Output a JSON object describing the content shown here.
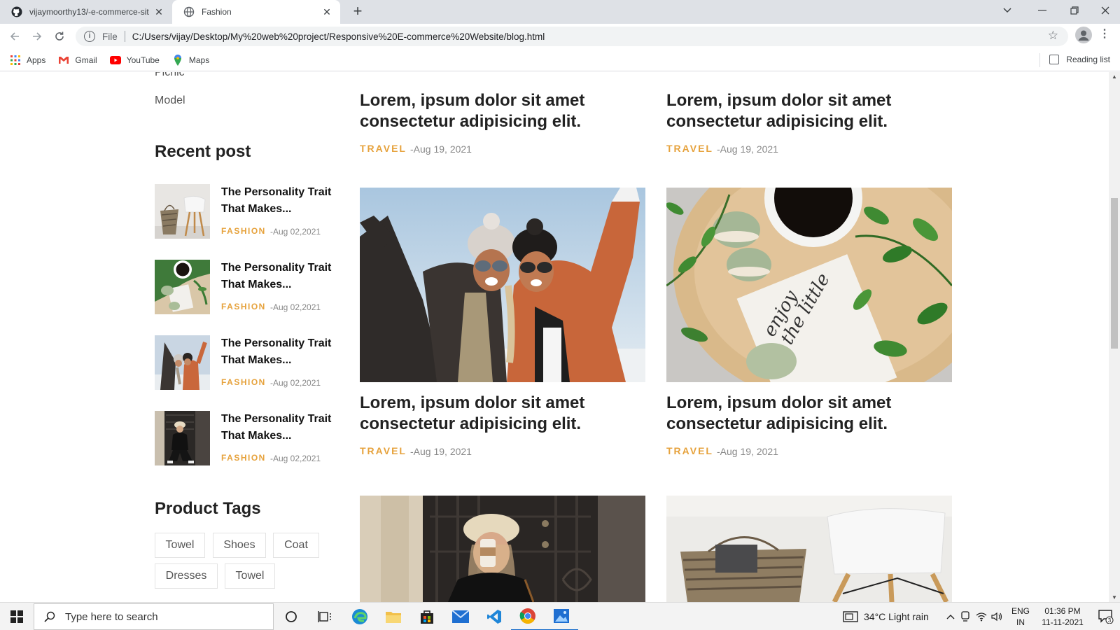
{
  "browser": {
    "tabs": [
      {
        "title": "vijaymoorthy13/-e-commerce-sit",
        "active": false
      },
      {
        "title": "Fashion",
        "active": true
      }
    ],
    "address": {
      "scheme_label": "File",
      "url": "C:/Users/vijay/Desktop/My%20web%20project/Responsive%20E-commerce%20Website/blog.html"
    },
    "bookmarks": [
      {
        "label": "Apps",
        "icon": "apps-grid-icon"
      },
      {
        "label": "Gmail",
        "icon": "gmail-icon"
      },
      {
        "label": "YouTube",
        "icon": "youtube-icon"
      },
      {
        "label": "Maps",
        "icon": "maps-icon"
      }
    ],
    "reading_list": "Reading list",
    "colors": {
      "tabstrip": "#dee1e6",
      "omnibox": "#f1f3f4"
    }
  },
  "sidebar": {
    "categories": [
      "Picnic",
      "Model"
    ],
    "recent_title": "Recent post",
    "recent_posts": [
      {
        "title": "The Personality Trait That Makes...",
        "category": "FASHION",
        "date": "-Aug 02,2021",
        "image": "basket-chair"
      },
      {
        "title": "The Personality Trait That Makes...",
        "category": "FASHION",
        "date": "-Aug 02,2021",
        "image": "coffee-macarons"
      },
      {
        "title": "The Personality Trait That Makes...",
        "category": "FASHION",
        "date": "-Aug 02,2021",
        "image": "two-women-snow"
      },
      {
        "title": "The Personality Trait That Makes...",
        "category": "FASHION",
        "date": "-Aug 02,2021",
        "image": "woman-black-outfit"
      }
    ],
    "tags_title": "Product Tags",
    "tags": [
      "Towel",
      "Shoes",
      "Coat",
      "Dresses",
      "Towel"
    ]
  },
  "posts": [
    {
      "title": "Lorem, ipsum dolor sit amet consectetur adipisicing elit.",
      "category": "TRAVEL",
      "date": "-Aug 19, 2021"
    },
    {
      "title": "Lorem, ipsum dolor sit amet consectetur adipisicing elit.",
      "category": "TRAVEL",
      "date": "-Aug 19, 2021"
    },
    {
      "title": "Lorem, ipsum dolor sit amet consectetur adipisicing elit.",
      "category": "TRAVEL",
      "date": "-Aug 19, 2021",
      "image": "two-women-snow"
    },
    {
      "title": "Lorem, ipsum dolor sit amet consectetur adipisicing elit.",
      "category": "TRAVEL",
      "date": "-Aug 19, 2021",
      "image": "coffee-macarons"
    },
    {
      "image": "woman-coffee-cup"
    },
    {
      "image": "basket-chair"
    }
  ],
  "accent_color": "#e6a23c",
  "taskbar": {
    "search_placeholder": "Type here to search",
    "weather": "34°C  Light rain",
    "lang_top": "ENG",
    "lang_bottom": "IN",
    "time": "01:36 PM",
    "date": "11-11-2021",
    "notification_count": "3"
  }
}
